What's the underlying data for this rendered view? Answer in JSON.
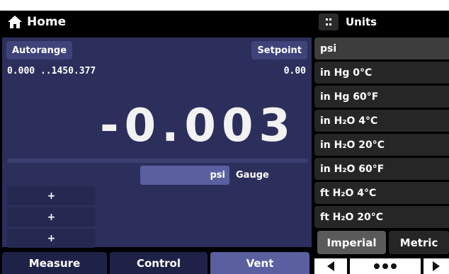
{
  "header": {
    "title": "Home",
    "home_icon": "home-icon"
  },
  "units_panel": {
    "title": "Units",
    "menu_icon": "grid-menu-icon"
  },
  "main": {
    "autorange_label": "Autorange",
    "setpoint_label": "Setpoint",
    "range_text": "0.000 ..1450.377",
    "setpoint_value": "0.00",
    "reading": "-0.003",
    "unit": "psi",
    "mode": "Gauge",
    "plus_buttons": [
      "+",
      "+",
      "+"
    ]
  },
  "tabs": [
    {
      "label": "Measure",
      "active": false
    },
    {
      "label": "Control",
      "active": false
    },
    {
      "label": "Vent",
      "active": true
    }
  ],
  "units_list": [
    {
      "label": "psi",
      "selected": true
    },
    {
      "label": "in Hg 0°C",
      "selected": false
    },
    {
      "label": "in Hg 60°F",
      "selected": false
    },
    {
      "label": "in H₂O 4°C",
      "selected": false
    },
    {
      "label": "in H₂O 20°C",
      "selected": false
    },
    {
      "label": "in H₂O 60°F",
      "selected": false
    },
    {
      "label": "ft H₂O 4°C",
      "selected": false
    },
    {
      "label": "ft H₂O 20°C",
      "selected": false
    }
  ],
  "unit_systems": {
    "imperial": "Imperial",
    "metric": "Metric",
    "active": "imperial"
  },
  "pager": {
    "prev_icon": "arrow-left-icon",
    "dots_icon": "more-dots-icon",
    "next_icon": "arrow-right-icon"
  },
  "colors": {
    "panel": "#2c2f5c",
    "active_tab": "#5a5fa0",
    "list_bg": "#262626"
  }
}
